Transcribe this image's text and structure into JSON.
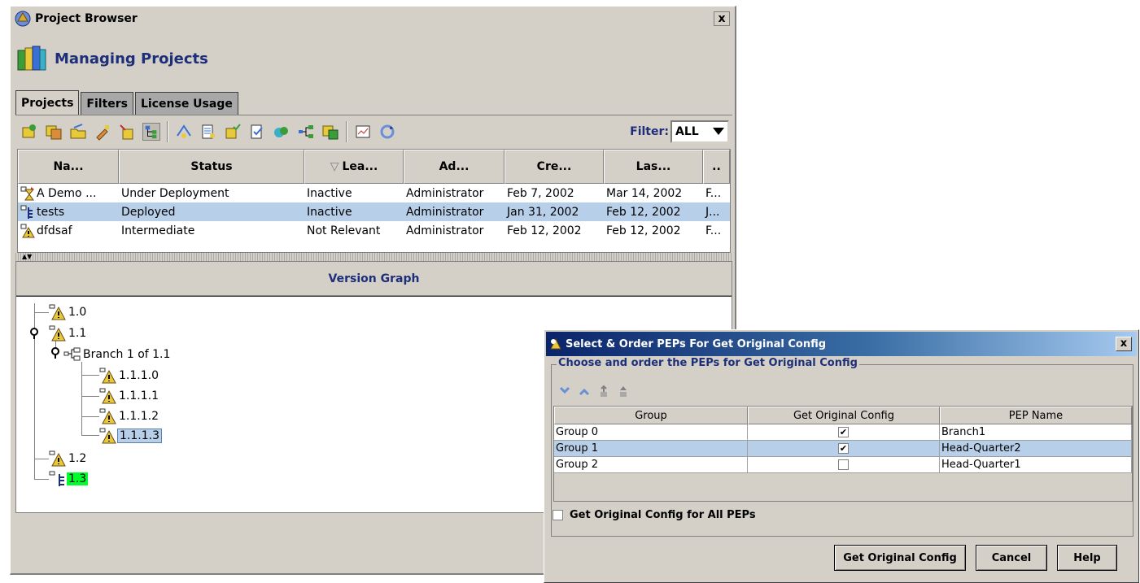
{
  "window": {
    "title": "Project Browser",
    "close_symbol": "x",
    "header": "Managing Projects"
  },
  "tabs": [
    {
      "label": "Projects",
      "active": true
    },
    {
      "label": "Filters",
      "active": false
    },
    {
      "label": "License Usage",
      "active": false
    }
  ],
  "toolbar": {
    "icons": [
      "new-project-icon",
      "copy-project-icon",
      "open-project-icon",
      "edit-project-icon",
      "import-project-icon",
      "tree-view-icon",
      "deploy-icon",
      "report-icon",
      "approve-icon",
      "validate-icon",
      "compare-icon",
      "branch-icon",
      "merge-icon",
      "schedule-icon",
      "refresh-icon"
    ],
    "filter_label": "Filter:",
    "filter_value": "ALL"
  },
  "projects": {
    "columns": [
      "Na...",
      "Status",
      "Lea...",
      "Ad...",
      "Cre...",
      "Las...",
      ".."
    ],
    "sort_indicator": "▽",
    "rows": [
      {
        "name": "A Demo ...",
        "status": "Under Deployment",
        "lease": "Inactive",
        "admin": "Administrator",
        "created": "Feb 7, 2002",
        "last": "Mar 14, 2002",
        "extra": "F...",
        "icon": "hourglass-icon"
      },
      {
        "name": "tests",
        "status": "Deployed",
        "lease": "Inactive",
        "admin": "Administrator",
        "created": "Jan 31, 2002",
        "last": "Feb 12, 2002",
        "extra": "J...",
        "icon": "tree-icon",
        "selected": true
      },
      {
        "name": "dfdsaf",
        "status": "Intermediate",
        "lease": "Not Relevant",
        "admin": "Administrator",
        "created": "Feb 12, 2002",
        "last": "Feb 12, 2002",
        "extra": "F...",
        "icon": "warning-icon"
      }
    ]
  },
  "version_graph": {
    "title": "Version Graph",
    "nodes": [
      "1.0",
      "1.1",
      "Branch 1 of 1.1",
      "1.1.1.0",
      "1.1.1.1",
      "1.1.1.2",
      "1.1.1.3",
      "1.2",
      "1.3"
    ]
  },
  "dialog": {
    "title": "Select & Order PEPs For Get Original Config",
    "close_symbol": "x",
    "group_label": "Choose and order the PEPs for Get Original Config",
    "columns": [
      "Group",
      "Get Original Config",
      "PEP Name"
    ],
    "rows": [
      {
        "group": "Group 0",
        "checked": true,
        "checkmark": "✔",
        "pep": "Branch1"
      },
      {
        "group": "Group 1",
        "checked": true,
        "checkmark": "✔",
        "pep": "Head-Quarter2",
        "selected": true
      },
      {
        "group": "Group 2",
        "checked": false,
        "checkmark": "",
        "pep": "Head-Quarter1"
      }
    ],
    "all_peps_label": "Get Original Config for All PEPs",
    "all_peps_checked": false,
    "buttons": {
      "primary": "Get Original Config",
      "cancel": "Cancel",
      "help": "Help"
    }
  },
  "colors": {
    "selection": "#b8cfe9",
    "header_blue": "#1e2f7a",
    "current_version": "#00ff2a",
    "window_bg": "#d4d0c8"
  }
}
